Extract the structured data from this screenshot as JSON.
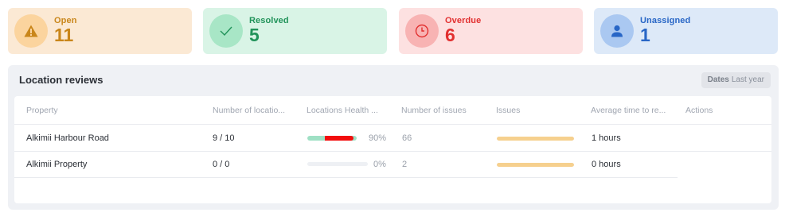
{
  "stats": [
    {
      "label": "Open",
      "value": "11",
      "icon": "warning-icon"
    },
    {
      "label": "Resolved",
      "value": "5",
      "icon": "check-icon"
    },
    {
      "label": "Overdue",
      "value": "6",
      "icon": "clock-icon"
    },
    {
      "label": "Unassigned",
      "value": "1",
      "icon": "user-icon"
    }
  ],
  "panel": {
    "title": "Location reviews",
    "dates_label": "Dates",
    "dates_value": "Last year"
  },
  "table": {
    "columns": [
      "Property",
      "Number of locatio...",
      "Locations Health ...",
      "Number of issues",
      "Issues",
      "Average time to re...",
      "Actions"
    ],
    "rows": [
      {
        "property": "Alkimii Harbour Road",
        "locations": "9 / 10",
        "health_pct": "90%",
        "health": 0.9,
        "issues_count": "66",
        "issues": 1.0,
        "avg_time": "1 hours"
      },
      {
        "property": "Alkimii Property",
        "locations": "0 / 0",
        "health_pct": "0%",
        "health": 0.0,
        "issues_count": "2",
        "issues": 1.0,
        "avg_time": "0 hours"
      }
    ]
  },
  "colors": {
    "health_good": "#9fe0c4",
    "health_bad": "#f20d0d",
    "issues_bar": "#f6d08e"
  }
}
